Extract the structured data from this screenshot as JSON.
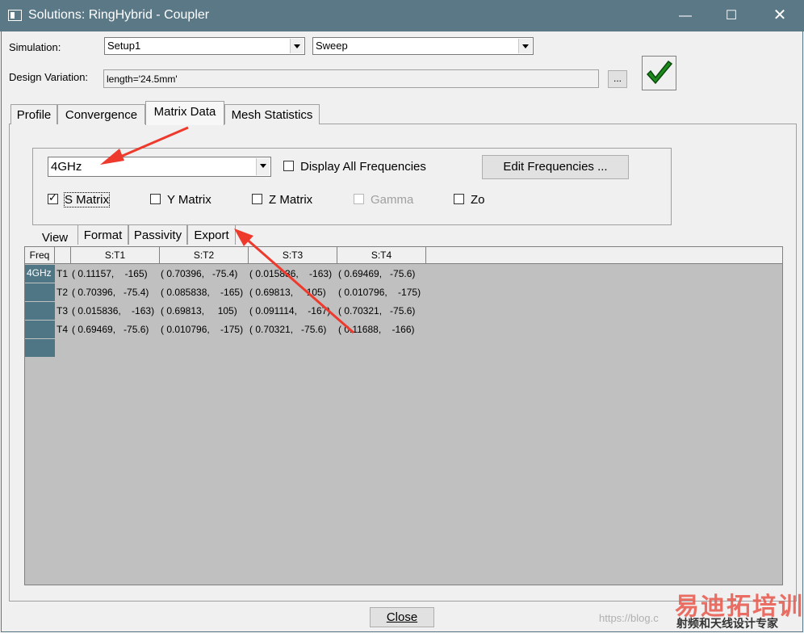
{
  "window": {
    "title": "Solutions: RingHybrid - Coupler"
  },
  "simulation": {
    "label": "Simulation:",
    "setup": "Setup1",
    "sweep": "Sweep"
  },
  "design_variation": {
    "label": "Design Variation:",
    "value": "length='24.5mm'",
    "browse_label": "..."
  },
  "tabs": [
    {
      "label": "Profile"
    },
    {
      "label": "Convergence"
    },
    {
      "label": "Matrix Data"
    },
    {
      "label": "Mesh Statistics"
    }
  ],
  "frequency": {
    "value": "4GHz",
    "display_all_label": "Display All Frequencies",
    "edit_label": "Edit Frequencies ..."
  },
  "matrix_types": [
    {
      "label": "S Matrix",
      "checked": true
    },
    {
      "label": "Y Matrix",
      "checked": false
    },
    {
      "label": "Z Matrix",
      "checked": false
    },
    {
      "label": "Gamma",
      "checked": false,
      "disabled": true
    },
    {
      "label": "Zo",
      "checked": false
    }
  ],
  "subtabs": [
    {
      "label": "View"
    },
    {
      "label": "Format"
    },
    {
      "label": "Passivity"
    },
    {
      "label": "Export"
    }
  ],
  "grid": {
    "freq_header": "Freq",
    "columns": [
      "S:T1",
      "S:T2",
      "S:T3",
      "S:T4"
    ],
    "freq_value": "4GHz",
    "rows": [
      {
        "port": "T1",
        "cells": [
          "( 0.11157,    -165)",
          "( 0.70396,   -75.4)",
          "( 0.015836,    -163)",
          "( 0.69469,   -75.6)"
        ]
      },
      {
        "port": "T2",
        "cells": [
          "( 0.70396,   -75.4)",
          "( 0.085838,    -165)",
          "( 0.69813,     105)",
          "( 0.010796,    -175)"
        ]
      },
      {
        "port": "T3",
        "cells": [
          "( 0.015836,    -163)",
          "( 0.69813,     105)",
          "( 0.091114,    -167)",
          "( 0.70321,   -75.6)"
        ]
      },
      {
        "port": "T4",
        "cells": [
          "( 0.69469,   -75.6)",
          "( 0.010796,    -175)",
          "( 0.70321,   -75.6)",
          "( 0.11688,    -166)"
        ]
      }
    ]
  },
  "close_label": "Close",
  "watermark": {
    "brand": "易迪拓培训",
    "slogan": "射频和天线设计专家",
    "url": "https://blog.c"
  },
  "colors": {
    "titlebar": "#5a7886",
    "row_header": "#4f7685",
    "annotation_arrow": "#ee3a2d",
    "check_icon": "#1e8a1e"
  }
}
